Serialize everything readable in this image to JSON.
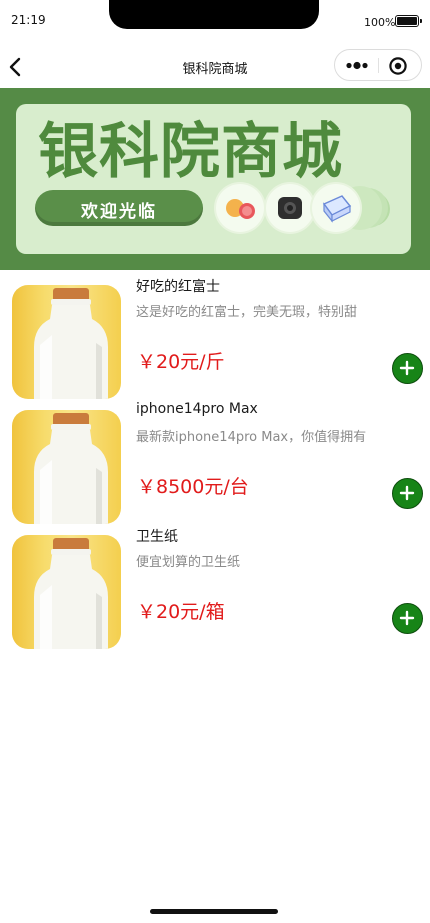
{
  "status_bar": {
    "time": "21:19",
    "battery": "100%"
  },
  "nav": {
    "title": "银科院商城",
    "back_icon": "chevron-left-icon",
    "more_icon": "more-dots-icon",
    "close_icon": "target-circle-icon"
  },
  "banner": {
    "title": "银科院商城",
    "welcome": "欢迎光临",
    "colors": {
      "outer": "#558b46",
      "card": "#d8edcd",
      "title": "#4f8a3d"
    },
    "product_icons": [
      "fruit-icon",
      "speaker-icon",
      "box-icon"
    ]
  },
  "products": [
    {
      "name": "好吃的红富士",
      "desc": "这是好吃的红富士，完美无瑕，特别甜",
      "price": "￥20元/斤"
    },
    {
      "name": "iphone14pro Max",
      "desc": "最新款iphone14pro Max，你值得拥有",
      "price": "￥8500元/台"
    },
    {
      "name": "卫生纸",
      "desc": "便宜划算的卫生纸",
      "price": "￥20元/箱"
    }
  ],
  "colors": {
    "price": "#e11b1b",
    "add_button": "#178417"
  }
}
